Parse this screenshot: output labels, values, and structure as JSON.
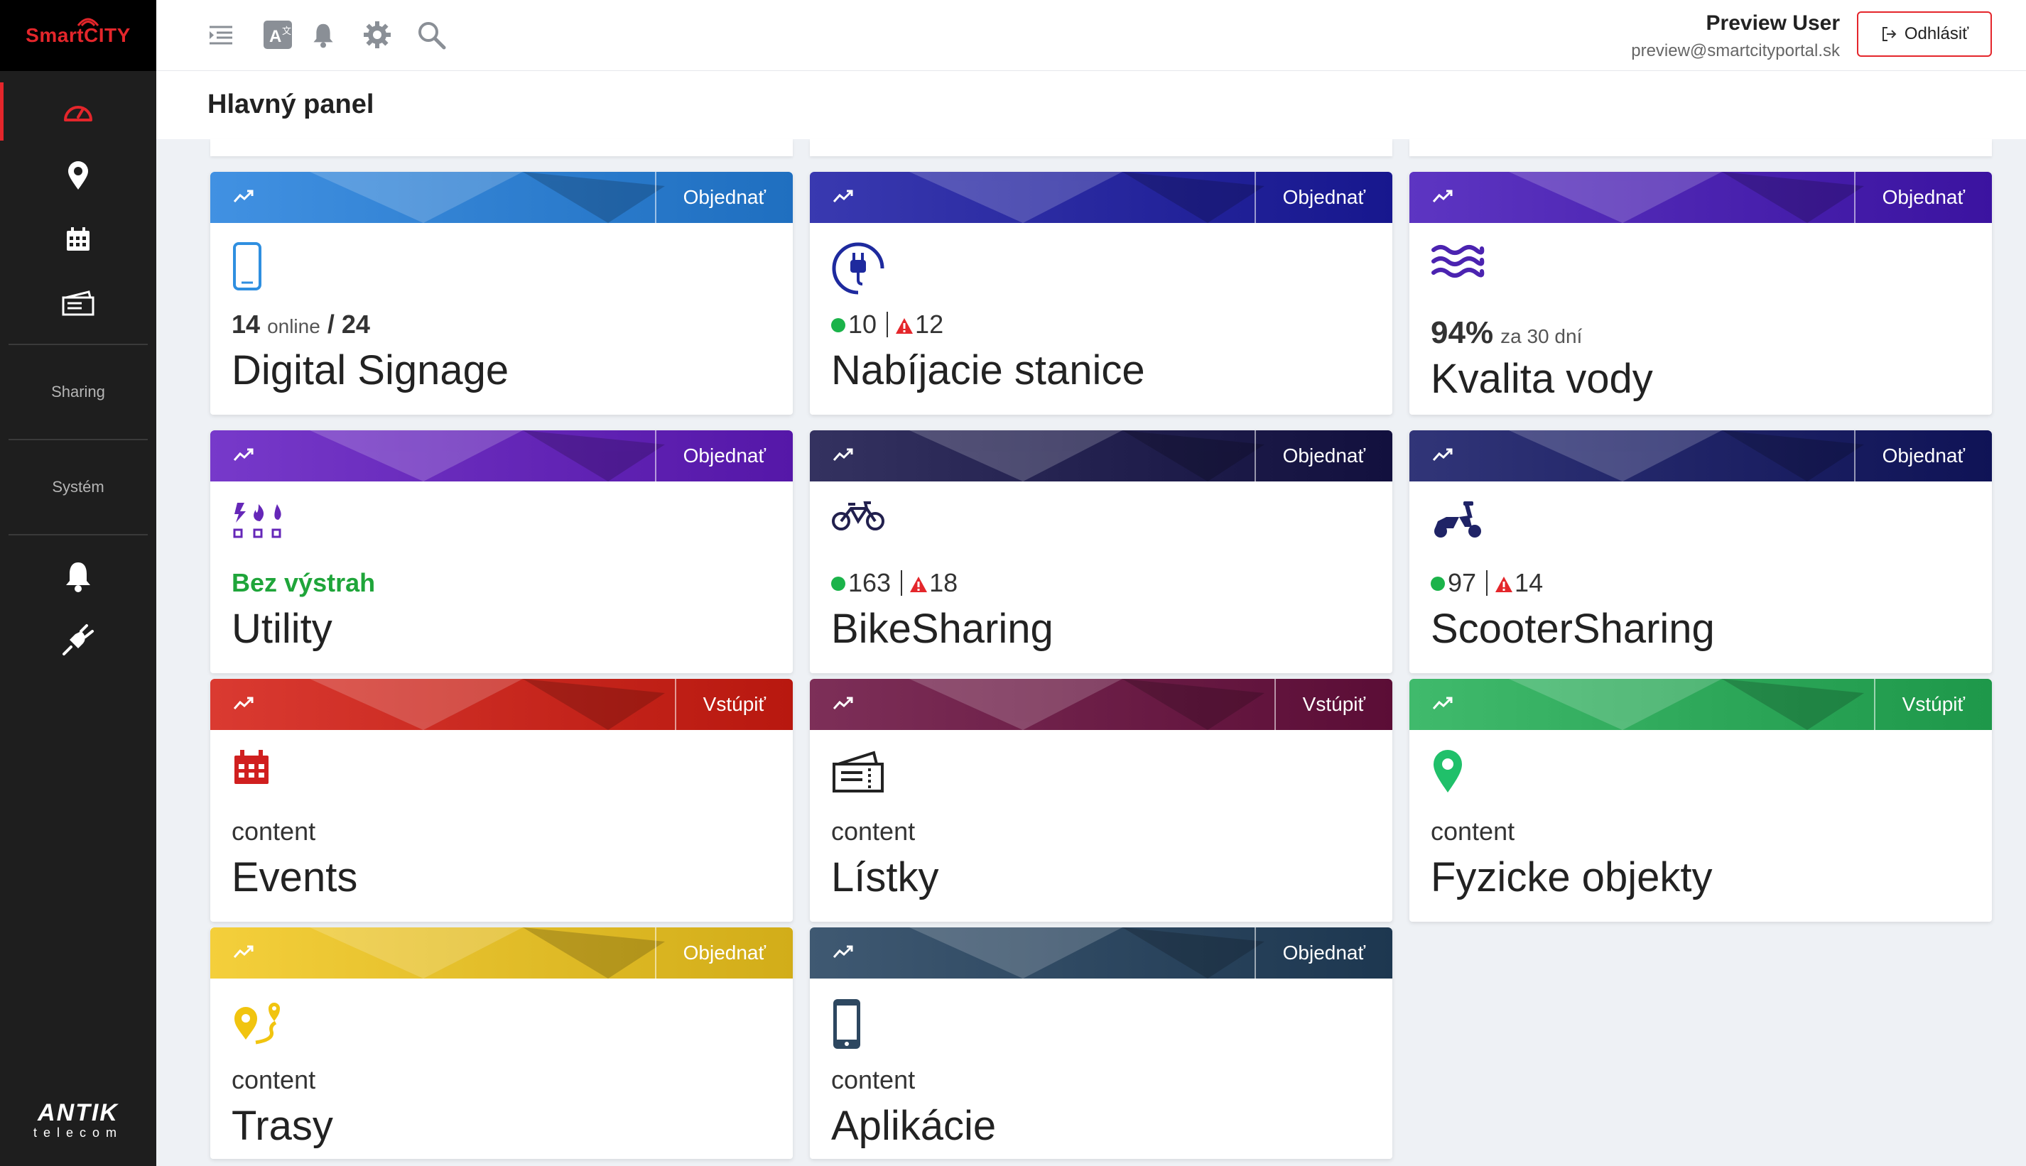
{
  "sidebar": {
    "logo_text": "SmartCITY",
    "nav_icons": [
      "dashboard-icon",
      "map-pin-icon",
      "calendar-icon",
      "tickets-icon"
    ],
    "section_sharing": "Sharing",
    "section_system": "Systém",
    "bottom_icons": [
      "bell-icon",
      "plug-icon"
    ],
    "brand_top": "ANTIK",
    "brand_bottom": "telecom"
  },
  "header": {
    "icons": [
      "menu-toggle-icon",
      "translate-icon",
      "bell-icon",
      "gear-icon",
      "search-icon"
    ],
    "user_name": "Preview User",
    "user_email": "preview@smartcityportal.sk",
    "logout_label": "Odhlásiť"
  },
  "page": {
    "title": "Hlavný panel"
  },
  "colors": {
    "accent": "#e4262b",
    "sidebar_bg": "#1e1e1e",
    "ok": "#1bb34a",
    "alert": "#e4262b"
  },
  "tiles": [
    {
      "id": "digital-signage",
      "name": "Digital Signage",
      "action": "Objednať",
      "online": "14",
      "online_label": "online",
      "total_sep": "/",
      "total": "24",
      "color": "#2f7fd0"
    },
    {
      "id": "charging",
      "name": "Nabíjacie stanice",
      "action": "Objednať",
      "ok": "10",
      "alerts": "12",
      "color": "#27279e"
    },
    {
      "id": "water",
      "name": "Kvalita vody",
      "action": "Objednať",
      "percent": "94%",
      "period": "za 30 dní",
      "color": "#4b23b0"
    },
    {
      "id": "utility",
      "name": "Utility",
      "action": "Objednať",
      "status": "Bez výstrah",
      "color": "#6527b8"
    },
    {
      "id": "bike",
      "name": "BikeSharing",
      "action": "Objednať",
      "ok": "163",
      "alerts": "18",
      "color": "#22204e"
    },
    {
      "id": "scooter",
      "name": "ScooterSharing",
      "action": "Objednať",
      "ok": "97",
      "alerts": "14",
      "color": "#1f2366"
    },
    {
      "id": "events",
      "name": "Events",
      "action": "Vstúpiť",
      "sub": "content",
      "color": "#c8281f"
    },
    {
      "id": "tickets",
      "name": "Lístky",
      "action": "Vstúpiť",
      "sub": "content",
      "color": "#6b1d46"
    },
    {
      "id": "objects",
      "name": "Fyzicke objekty",
      "action": "Vstúpiť",
      "sub": "content",
      "color": "#2ea85a"
    },
    {
      "id": "routes",
      "name": "Trasy",
      "action": "Objednať",
      "sub": "content",
      "color": "#e2bd29"
    },
    {
      "id": "apps",
      "name": "Aplikácie",
      "action": "Objednať",
      "sub": "content",
      "color": "#2d4760"
    }
  ]
}
